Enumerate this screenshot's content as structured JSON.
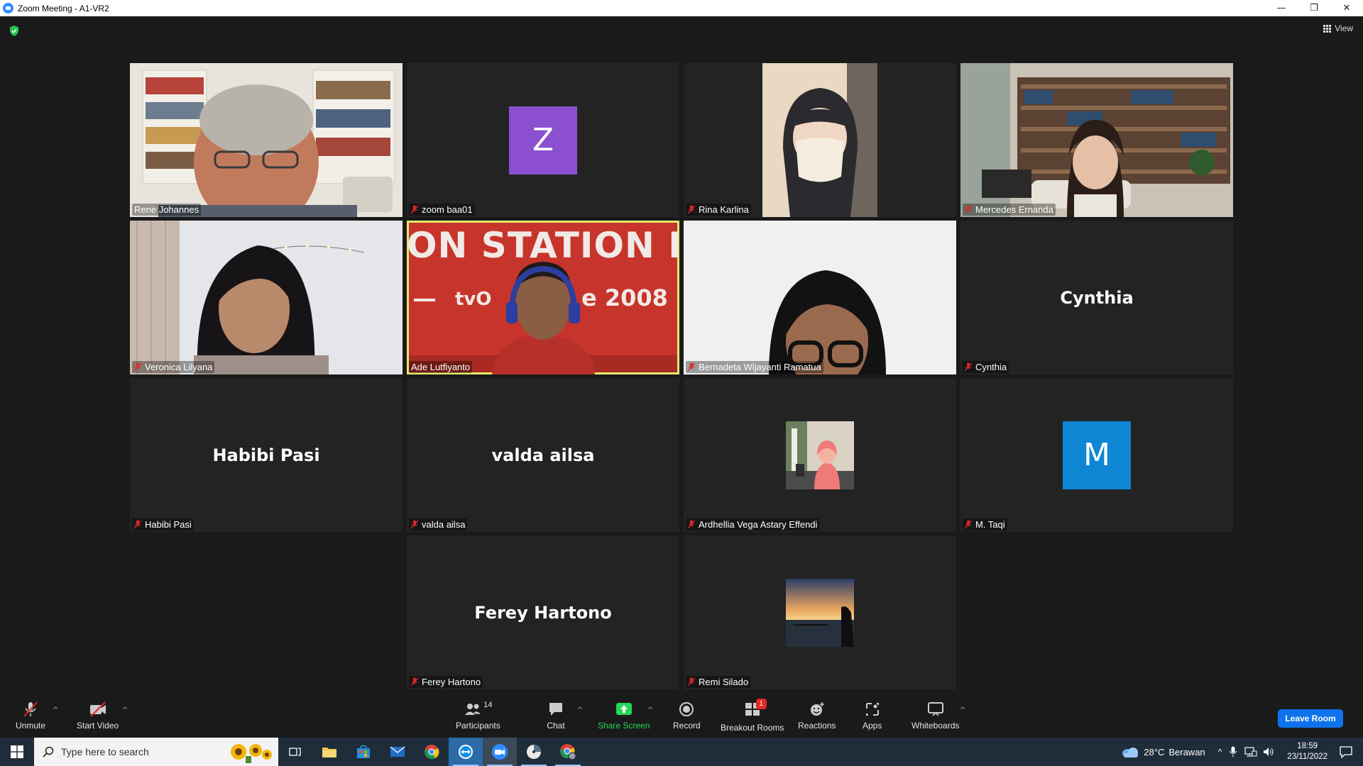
{
  "window": {
    "title": "Zoom Meeting - A1-VR2",
    "minimize": "—",
    "restore": "❐",
    "close": "✕"
  },
  "header": {
    "view_label": "View"
  },
  "tiles": [
    {
      "name": "Rene Johannes",
      "muted": false,
      "kind": "video"
    },
    {
      "name": "zoom baa01",
      "muted": true,
      "kind": "avatar",
      "initial": "Z",
      "color": "#8b4fcf"
    },
    {
      "name": "Rina Karlina",
      "muted": true,
      "kind": "video"
    },
    {
      "name": "Mercedes Ernanda",
      "muted": true,
      "kind": "video"
    },
    {
      "name": "Veronica Lilyana",
      "muted": true,
      "kind": "video"
    },
    {
      "name": "Ade Lutfiyanto",
      "muted": false,
      "kind": "video",
      "active": true,
      "banner_line1": "ON STATION IN",
      "banner_line2": "tvO",
      "banner_year": "e 2008"
    },
    {
      "name": "Bernadeta Wijayanti Ramatua",
      "muted": true,
      "kind": "video"
    },
    {
      "name": "Cynthia",
      "muted": true,
      "kind": "name",
      "display": "Cynthia"
    },
    {
      "name": "Habibi Pasi",
      "muted": true,
      "kind": "name",
      "display": "Habibi Pasi"
    },
    {
      "name": "valda ailsa",
      "muted": true,
      "kind": "name",
      "display": "valda ailsa"
    },
    {
      "name": "Ardhellia Vega Astary Effendi",
      "muted": true,
      "kind": "photo"
    },
    {
      "name": "M. Taqi",
      "muted": true,
      "kind": "avatar",
      "initial": "M",
      "color": "#0e86d4"
    },
    {
      "name": "Ferey Hartono",
      "muted": true,
      "kind": "name",
      "display": "Ferey Hartono"
    },
    {
      "name": "Remi Silado",
      "muted": true,
      "kind": "photo2"
    }
  ],
  "toolbar": {
    "unmute": "Unmute",
    "start_video": "Start Video",
    "participants": "Participants",
    "participants_count": "14",
    "chat": "Chat",
    "share_screen": "Share Screen",
    "record": "Record",
    "breakout_rooms": "Breakout Rooms",
    "breakout_badge": "1",
    "reactions": "Reactions",
    "apps": "Apps",
    "whiteboards": "Whiteboards",
    "leave": "Leave Room"
  },
  "taskbar": {
    "search_placeholder": "Type here to search",
    "weather_temp": "28°C",
    "weather_desc": "Berawan",
    "time": "18:59",
    "date": "23/11/2022"
  },
  "colors": {
    "accent": "#0e72ed",
    "active_speaker": "#e1e96d",
    "muted_red": "#e02828",
    "share_green": "#23d959"
  }
}
